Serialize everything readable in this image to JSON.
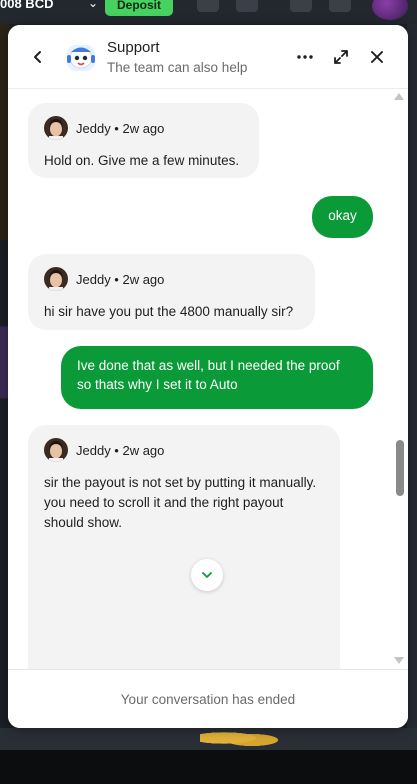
{
  "background_app": {
    "balance": "008 BCD",
    "deposit_label": "Deposit"
  },
  "chat": {
    "header": {
      "title": "Support",
      "subtitle": "The team can also help",
      "back_icon": "chevron-left-icon",
      "more_icon": "more-horizontal-icon",
      "expand_icon": "expand-icon",
      "close_icon": "close-icon"
    },
    "messages": [
      {
        "sender": "agent",
        "agent_name": "Jeddy",
        "time": "Jeddy • 2w ago",
        "text": "Hold on. Give me a few minutes."
      },
      {
        "sender": "user",
        "text": "okay"
      },
      {
        "sender": "agent",
        "agent_name": "Jeddy",
        "time": "Jeddy • 2w ago",
        "text": "hi sir have you put the 4800 manually sir?"
      },
      {
        "sender": "user",
        "text": "Ive done that as well, but I needed the proof so thats why I set it to Auto"
      },
      {
        "sender": "agent",
        "agent_name": "Jeddy",
        "time": "Jeddy • 2w ago",
        "text": "sir the payout is not set by putting it manually. you need to scroll it and the right payout should show."
      }
    ],
    "footer": {
      "ended_text": "Your conversation has ended"
    },
    "colors": {
      "user_bubble": "#0a9b38",
      "agent_bubble": "#f3f3f3",
      "deposit_button": "#46d160"
    }
  }
}
